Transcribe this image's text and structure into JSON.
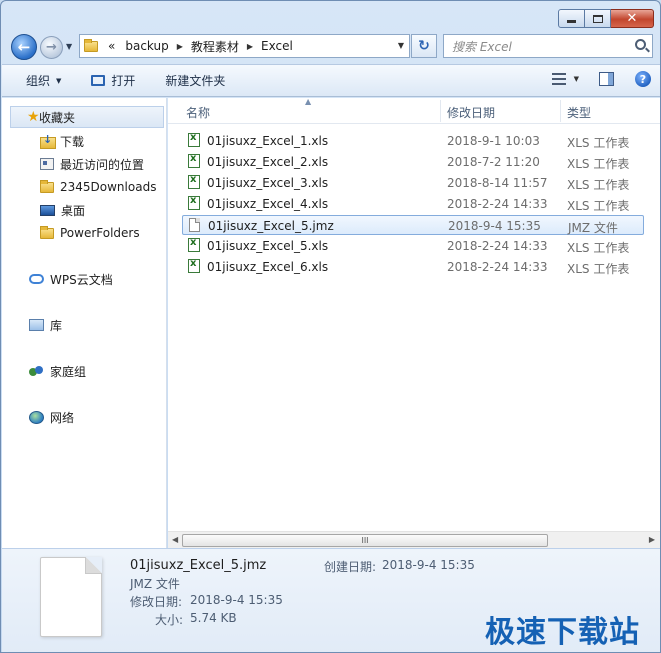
{
  "window": {
    "min_symbol": "",
    "close_symbol": "✕"
  },
  "address": {
    "overflow": "«",
    "segments": [
      "backup",
      "教程素材",
      "Excel"
    ]
  },
  "search": {
    "placeholder": "搜索 Excel"
  },
  "toolbar": {
    "organize_label": "组织",
    "open_label": "打开",
    "new_folder_label": "新建文件夹"
  },
  "nav": {
    "favorites_label": "收藏夹",
    "favorites_items": [
      "下载",
      "最近访问的位置",
      "2345Downloads",
      "桌面",
      "PowerFolders"
    ],
    "wps_label": "WPS云文档",
    "library_label": "库",
    "homegroup_label": "家庭组",
    "network_label": "网络"
  },
  "columns": {
    "name": "名称",
    "modified": "修改日期",
    "type": "类型"
  },
  "files": [
    {
      "name": "01jisuxz_Excel_1.xls",
      "modified": "2018-9-1 10:03",
      "type": "XLS 工作表",
      "icon": "excel-file-icon"
    },
    {
      "name": "01jisuxz_Excel_2.xls",
      "modified": "2018-7-2 11:20",
      "type": "XLS 工作表",
      "icon": "excel-file-icon"
    },
    {
      "name": "01jisuxz_Excel_3.xls",
      "modified": "2018-8-14 11:57",
      "type": "XLS 工作表",
      "icon": "excel-file-icon"
    },
    {
      "name": "01jisuxz_Excel_4.xls",
      "modified": "2018-2-24 14:33",
      "type": "XLS 工作表",
      "icon": "excel-file-icon"
    },
    {
      "name": "01jisuxz_Excel_5.jmz",
      "modified": "2018-9-4 15:35",
      "type": "JMZ 文件",
      "icon": "blank-file-icon"
    },
    {
      "name": "01jisuxz_Excel_5.xls",
      "modified": "2018-2-24 14:33",
      "type": "XLS 工作表",
      "icon": "excel-file-icon"
    },
    {
      "name": "01jisuxz_Excel_6.xls",
      "modified": "2018-2-24 14:33",
      "type": "XLS 工作表",
      "icon": "excel-file-icon"
    }
  ],
  "selected_index": 4,
  "scrollbar": {
    "grip": "III"
  },
  "details": {
    "filename": "01jisuxz_Excel_5.jmz",
    "filetype": "JMZ 文件",
    "modified_label": "修改日期:",
    "modified_value": "2018-9-4 15:35",
    "size_label": "大小:",
    "size_value": "5.74 KB",
    "created_label": "创建日期:",
    "created_value": "2018-9-4 15:35"
  },
  "watermark": "极速下载站",
  "colors": {
    "accent": "#1561b4",
    "selection_border": "#84acdd",
    "close_button": "#c2462e"
  }
}
